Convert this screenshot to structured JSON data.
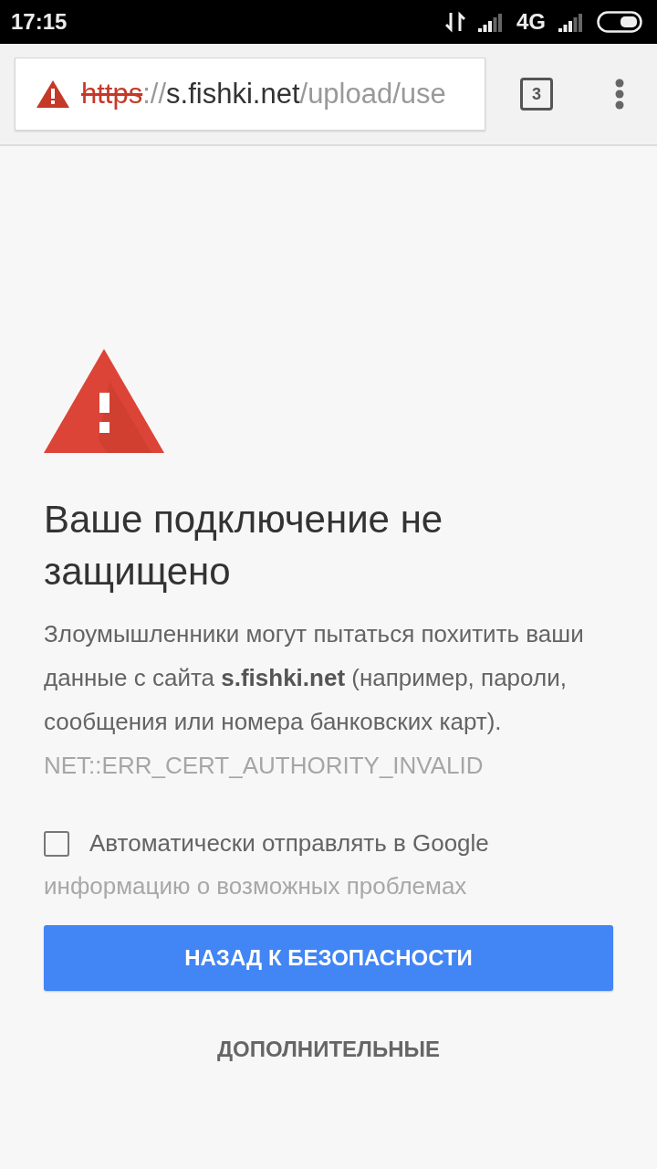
{
  "status_bar": {
    "time": "17:15",
    "network": "4G"
  },
  "address_bar": {
    "insecure": true,
    "scheme": "https",
    "separator": "://",
    "host": "s.fishki.net",
    "path": "/upload/use"
  },
  "tab_count": "3",
  "warning": {
    "heading": "Ваше подключение не защищено",
    "text": "Злоумышленники могут пытаться похитить ваши данные с сайта **s.fishki.net** (например, пароли, сообщения или номера банковских карт).",
    "error_code": "NET::ERR_CERT_AUTHORITY_INVALID"
  },
  "report_checkbox": {
    "checked": false,
    "label": "Автоматически отправлять в Google",
    "label_continuation": "информацию о возможных проблемах"
  },
  "buttons": {
    "primary": "НАЗАД К БЕЗОПАСНОСТИ",
    "secondary": "ДОПОЛНИТЕЛЬНЫЕ"
  }
}
